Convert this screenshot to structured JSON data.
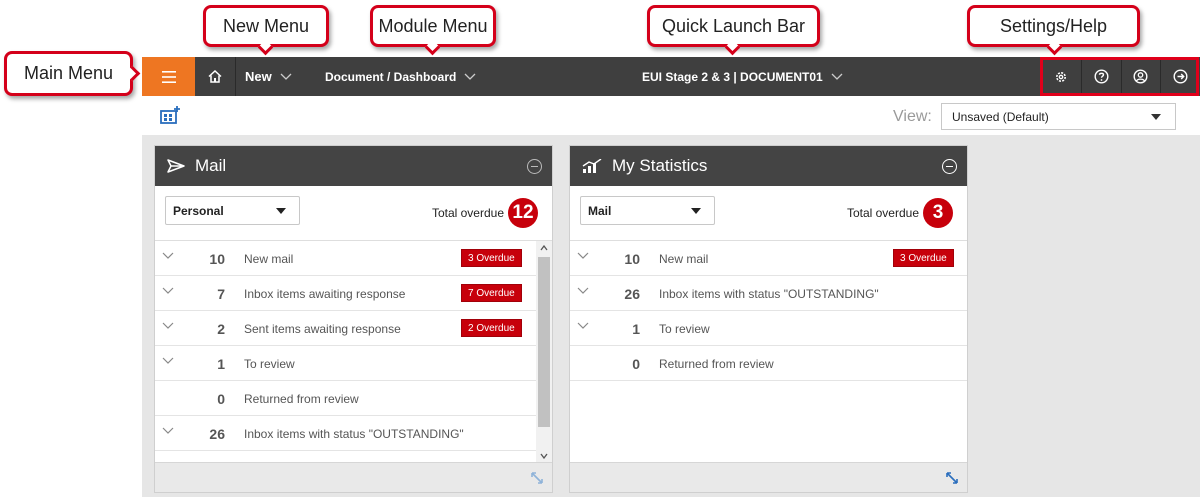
{
  "callouts": {
    "main_menu": "Main Menu",
    "new_menu": "New Menu",
    "module_menu": "Module Menu",
    "quick_launch": "Quick Launch Bar",
    "settings_help": "Settings/Help"
  },
  "topbar": {
    "new_label": "New",
    "module_label": "Document / Dashboard",
    "quick_launch_label": "EUI Stage 2 & 3 | DOCUMENT01"
  },
  "toolbar": {
    "view_label": "View:",
    "view_value": "Unsaved (Default)"
  },
  "mail_panel": {
    "title": "Mail",
    "filter": "Personal",
    "total_overdue_label": "Total overdue",
    "total_overdue": "12",
    "rows": [
      {
        "count": "10",
        "label": "New mail",
        "overdue": "3 Overdue"
      },
      {
        "count": "7",
        "label": "Inbox items awaiting response",
        "overdue": "7 Overdue"
      },
      {
        "count": "2",
        "label": "Sent items awaiting response",
        "overdue": "2 Overdue"
      },
      {
        "count": "1",
        "label": "To review",
        "overdue": ""
      },
      {
        "count": "0",
        "label": "Returned from review",
        "overdue": ""
      },
      {
        "count": "26",
        "label": "Inbox items with status \"OUTSTANDING\"",
        "overdue": ""
      }
    ]
  },
  "stats_panel": {
    "title": "My Statistics",
    "filter": "Mail",
    "total_overdue_label": "Total overdue",
    "total_overdue": "3",
    "rows": [
      {
        "count": "10",
        "label": "New mail",
        "overdue": "3 Overdue"
      },
      {
        "count": "26",
        "label": "Inbox items with status \"OUTSTANDING\"",
        "overdue": ""
      },
      {
        "count": "1",
        "label": "To review",
        "overdue": ""
      },
      {
        "count": "0",
        "label": "Returned from review",
        "overdue": ""
      }
    ]
  },
  "colors": {
    "accent_orange": "#ee7622",
    "topbar": "#3f3f3f",
    "overdue_red": "#c7000b",
    "callout_border": "#d4001a"
  },
  "icons": {
    "menu": "hamburger-icon",
    "home": "home-icon",
    "settings": "gear-icon",
    "help": "help-icon",
    "user": "user-icon",
    "logout": "logout-icon",
    "add_widget": "add-widget-icon",
    "mail": "send-icon",
    "stats": "chart-icon"
  }
}
